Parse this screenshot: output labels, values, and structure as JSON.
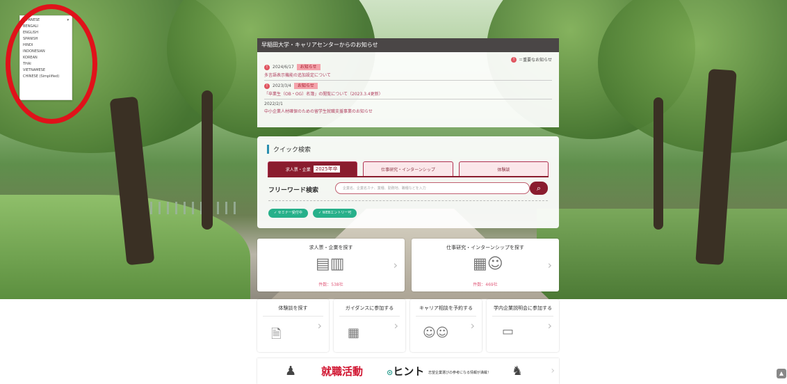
{
  "language_menu": {
    "selected": "JAPANESE",
    "options": [
      "BENGALI",
      "ENGLISH",
      "SPANISH",
      "HINDI",
      "INDONESIAN",
      "KOREAN",
      "THAI",
      "VIETNAMESE",
      "CHINESE (Simplified)"
    ]
  },
  "news": {
    "header": "早稲田大学・キャリアセンターからのお知らせ",
    "legend": "＝重要なお知らせ",
    "items": [
      {
        "date": "2024/6/17",
        "tag": "お知らせ",
        "text": "多言語表示機能の追加設定について"
      },
      {
        "date": "2023/3/4",
        "tag": "お知らせ",
        "text": "「卒業生（OB・OG）名簿」の閲覧について（2023.3.4更新）"
      },
      {
        "date": "2022/2/1",
        "tag": "",
        "text": "中小企業人材確保のための留学生就職支援事業のお知らせ"
      }
    ]
  },
  "quick_search": {
    "title": "クイック検索",
    "tabs": [
      {
        "label": "求人票・企業",
        "year": "2025年卒"
      },
      {
        "label": "仕事研究・インターンシップ",
        "year": ""
      },
      {
        "label": "体験談",
        "year": ""
      }
    ],
    "free_word_label": "フリーワード検索",
    "search_placeholder": "企業名、企業名カナ、業種、勤務地、職種などを入力",
    "search_icon": "magnifier",
    "buttons": [
      "セミナー受付中",
      "WEBエントリー可"
    ]
  },
  "cards": [
    {
      "title": "求人票・企業を探す",
      "count": "件数：538社",
      "icon": "documents-building"
    },
    {
      "title": "仕事研究・インターンシップを探す",
      "count": "件数：469社",
      "icon": "building-person"
    }
  ],
  "small_cards": [
    {
      "title": "体験談を探す",
      "icon": "document-search"
    },
    {
      "title": "ガイダンスに参加する",
      "icon": "calendar"
    },
    {
      "title": "キャリア相談を予約する",
      "icon": "consultation"
    },
    {
      "title": "学内企業説明会に参加する",
      "icon": "presentation"
    }
  ],
  "banner": {
    "main": "就職活動",
    "hint": "ヒント",
    "sub": "志望企業選びの参考になる情報が満載！"
  },
  "colors": {
    "accent": "#8a1c2e",
    "highlight": "#e0121a",
    "green": "#27b08a"
  }
}
